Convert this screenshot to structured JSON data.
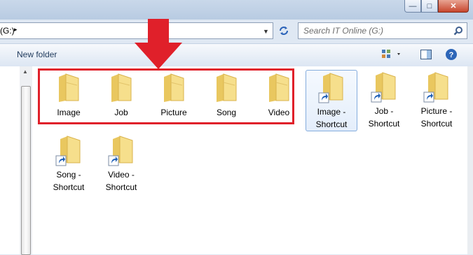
{
  "address": {
    "path_fragment": "(G:)",
    "chevron": "▸"
  },
  "search": {
    "placeholder": "Search IT Online (G:)"
  },
  "toolbar": {
    "new_folder": "New folder"
  },
  "window_controls": {
    "minimize": "—",
    "maximize": "□",
    "close": "✕"
  },
  "folders": [
    {
      "name": "Image"
    },
    {
      "name": "Job"
    },
    {
      "name": "Picture"
    },
    {
      "name": "Song"
    },
    {
      "name": "Video"
    }
  ],
  "shortcuts": [
    {
      "line1": "Image -",
      "line2": "Shortcut"
    },
    {
      "line1": "Job -",
      "line2": "Shortcut"
    },
    {
      "line1": "Picture -",
      "line2": "Shortcut"
    },
    {
      "line1": "Song -",
      "line2": "Shortcut"
    },
    {
      "line1": "Video -",
      "line2": "Shortcut"
    }
  ],
  "colors": {
    "highlight": "#e0202a",
    "folder": "#f3d97e",
    "accent": "#2a62b8"
  },
  "icons": [
    "folder-icon",
    "shortcut-arrow-icon",
    "search-icon",
    "refresh-icon",
    "views-icon",
    "preview-pane-icon",
    "help-icon"
  ]
}
